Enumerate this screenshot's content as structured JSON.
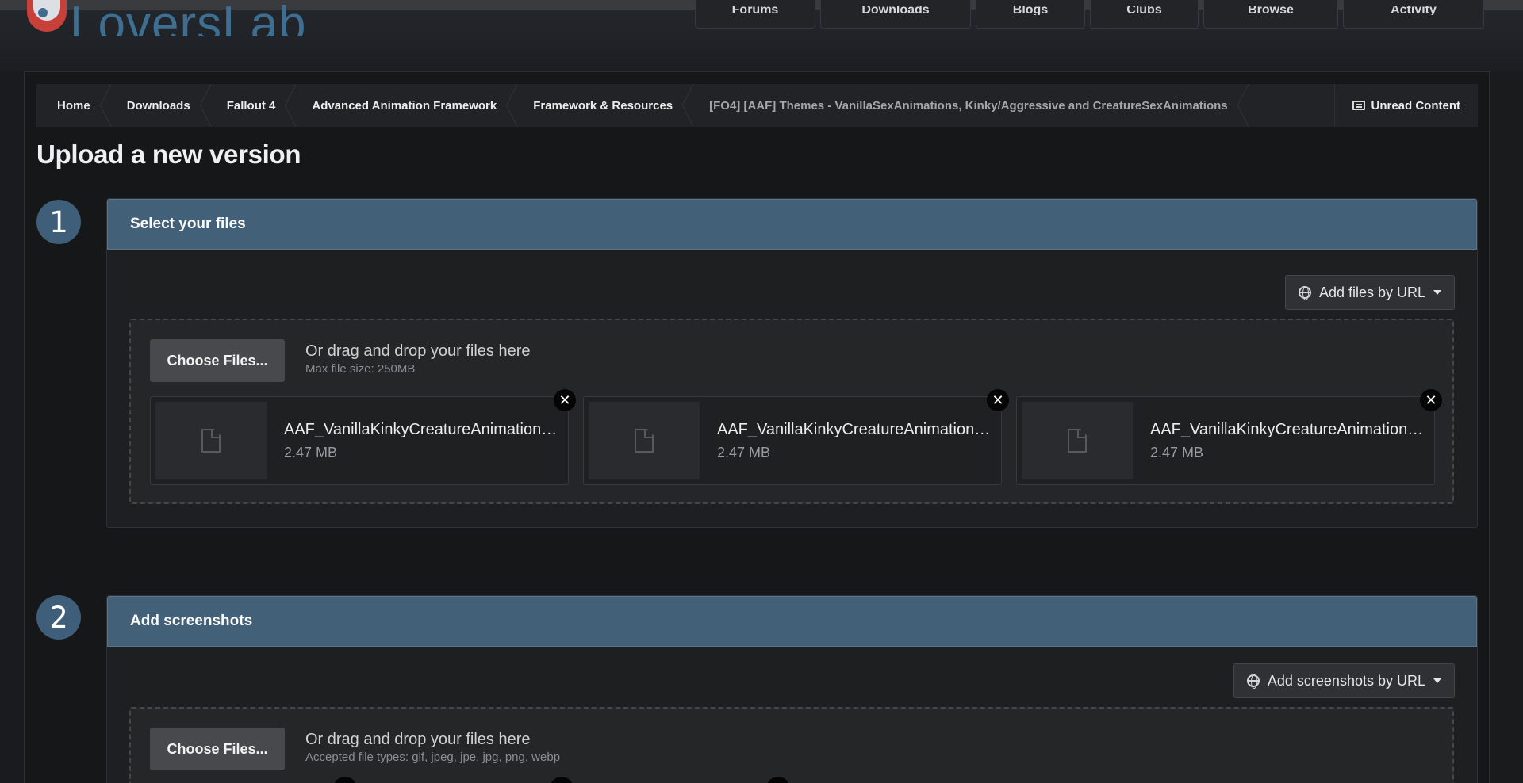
{
  "site": {
    "logo_text": "LoversLab",
    "nav": [
      "Forums",
      "Downloads",
      "Blogs",
      "Clubs",
      "Browse",
      "Activity"
    ]
  },
  "breadcrumb": {
    "items": [
      "Home",
      "Downloads",
      "Fallout 4",
      "Advanced Animation Framework",
      "Framework & Resources"
    ],
    "current": "[FO4] [AAF] Themes - VanillaSexAnimations, Kinky/Aggressive and CreatureSexAnimations",
    "unread": "Unread Content"
  },
  "page": {
    "title": "Upload a new version"
  },
  "step1": {
    "number": "1",
    "title": "Select your files",
    "url_button": "Add files by URL",
    "choose_button": "Choose Files...",
    "drop_text": "Or drag and drop your files here",
    "drop_sub": "Max file size: 250MB",
    "files": [
      {
        "name": "AAF_VanillaKinkyCreatureAnimations_...",
        "size": "2.47 MB"
      },
      {
        "name": "AAF_VanillaKinkyCreatureAnimations_...",
        "size": "2.47 MB"
      },
      {
        "name": "AAF_VanillaKinkyCreatureAnimations_...",
        "size": "2.47 MB"
      }
    ]
  },
  "step2": {
    "number": "2",
    "title": "Add screenshots",
    "url_button": "Add screenshots by URL",
    "choose_button": "Choose Files...",
    "drop_text": "Or drag and drop your files here",
    "drop_sub": "Accepted file types: gif, jpeg, jpe, jpg, png, webp"
  },
  "colors": {
    "accent_header": "#426179",
    "step_circle": "#3f5e79",
    "logo": "#3e6e91",
    "background": "#161718"
  }
}
